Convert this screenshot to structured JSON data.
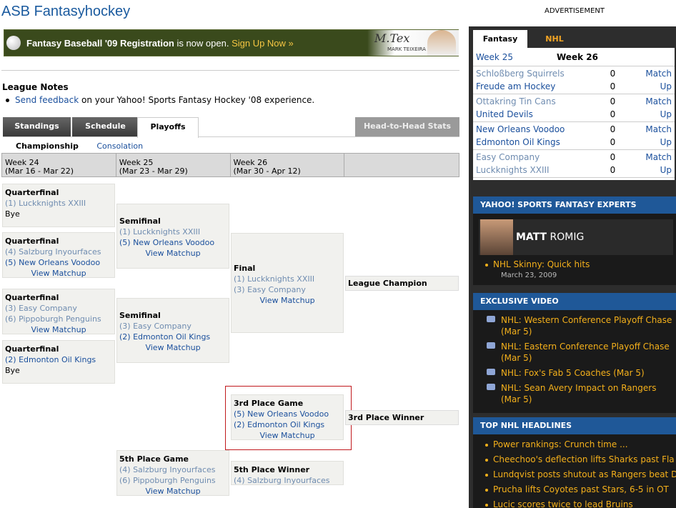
{
  "header": {
    "title": "ASB Fantasyhockey",
    "ad_label": "ADVERTISEMENT"
  },
  "banner": {
    "bold": "Fantasy Baseball '09 Registration",
    "rest": " is now open. ",
    "link": "Sign Up Now »",
    "caption": "MARK TEIXEIRA"
  },
  "notes": {
    "heading": "League Notes",
    "link": "Send feedback",
    "text": " on your Yahoo! Sports Fantasy Hockey '08 experience."
  },
  "tabs": [
    "Standings",
    "Schedule",
    "Playoffs",
    "Head-to-Head Stats"
  ],
  "subtabs": [
    "Championship",
    "Consolation"
  ],
  "weeks": [
    {
      "w": "Week 24",
      "d": "(Mar 16 - Mar 22)"
    },
    {
      "w": "Week 25",
      "d": "(Mar 23 - Mar 29)"
    },
    {
      "w": "Week 26",
      "d": "(Mar 30 - Apr 12)"
    }
  ],
  "bracket": {
    "qf1": {
      "h": "Quarterfinal",
      "t1": "(1) Luckknights XXIII",
      "t2": "Bye"
    },
    "qf2": {
      "h": "Quarterfinal",
      "t1": "(4) Salzburg Inyourfaces",
      "t2": "(5) New Orleans Voodoo",
      "vm": "View Matchup"
    },
    "qf3": {
      "h": "Quarterfinal",
      "t1": "(3) Easy Company",
      "t2": "(6) Pippoburgh Penguins",
      "vm": "View Matchup"
    },
    "qf4": {
      "h": "Quarterfinal",
      "t1": "(2) Edmonton Oil Kings",
      "t2": "Bye"
    },
    "sf1": {
      "h": "Semifinal",
      "t1": "(1) Luckknights XXIII",
      "t2": "(5) New Orleans Voodoo",
      "vm": "View Matchup"
    },
    "sf2": {
      "h": "Semifinal",
      "t1": "(3) Easy Company",
      "t2": "(2) Edmonton Oil Kings",
      "vm": "View Matchup"
    },
    "final": {
      "h": "Final",
      "t1": "(1) Luckknights XXIII",
      "t2": "(3) Easy Company",
      "vm": "View Matchup"
    },
    "champion": "League Champion",
    "third": {
      "h": "3rd Place Game",
      "t1": "(5) New Orleans Voodoo",
      "t2": "(2) Edmonton Oil Kings",
      "vm": "View Matchup"
    },
    "third_winner": "3rd Place Winner",
    "fifth": {
      "h": "5th Place Game",
      "t1": "(4) Salzburg Inyourfaces",
      "t2": "(6) Pippoburgh Penguins",
      "vm": "View Matchup"
    },
    "fifth_winner": {
      "h": "5th Place Winner",
      "t1": "(4) Salzburg Inyourfaces"
    }
  },
  "scoreboard": {
    "tabs": [
      "Fantasy",
      "NHL"
    ],
    "week_link": "Week 25",
    "week_current": "Week 26",
    "match_word": "Match",
    "up_word": "Up",
    "matchups": [
      {
        "a": "Schloßberg Squirrels",
        "as": "0",
        "b": "Freude am Hockey",
        "bs": "0",
        "a_grey": true,
        "b_grey": false
      },
      {
        "a": "Ottakring Tin Cans",
        "as": "0",
        "b": "United Devils",
        "bs": "0",
        "a_grey": true,
        "b_grey": false
      },
      {
        "a": "New Orleans Voodoo",
        "as": "0",
        "b": "Edmonton Oil Kings",
        "bs": "0",
        "a_grey": false,
        "b_grey": false
      },
      {
        "a": "Easy Company",
        "as": "0",
        "b": "Luckknights XXIII",
        "bs": "0",
        "a_grey": true,
        "b_grey": true
      }
    ]
  },
  "experts": {
    "heading": "YAHOO! SPORTS FANTASY EXPERTS",
    "first": "MATT",
    "last": " ROMIG",
    "link": "NHL Skinny: Quick hits",
    "date": "March 23, 2009"
  },
  "video": {
    "heading": "EXCLUSIVE VIDEO",
    "items": [
      "NHL: Western Conference Playoff Chase (Mar 5)",
      "NHL: Eastern Conference Playoff Chase (Mar 5)",
      "NHL: Fox's Fab 5 Coaches (Mar 5)",
      "NHL: Sean Avery Impact on Rangers (Mar 5)"
    ]
  },
  "headlines": {
    "heading": "TOP NHL HEADLINES",
    "items": [
      "Power rankings: Crunch time ...",
      "Cheechoo's deflection lifts Sharks past Fla",
      "Lundqvist posts shutout as Rangers beat D",
      "Prucha lifts Coyotes past Stars, 6-5 in OT",
      "Lucic scores twice to lead Bruins"
    ]
  },
  "colors": {
    "brand_blue": "#1a5a9e",
    "accent_orange": "#f4a524",
    "section_blue": "#1f5898"
  }
}
